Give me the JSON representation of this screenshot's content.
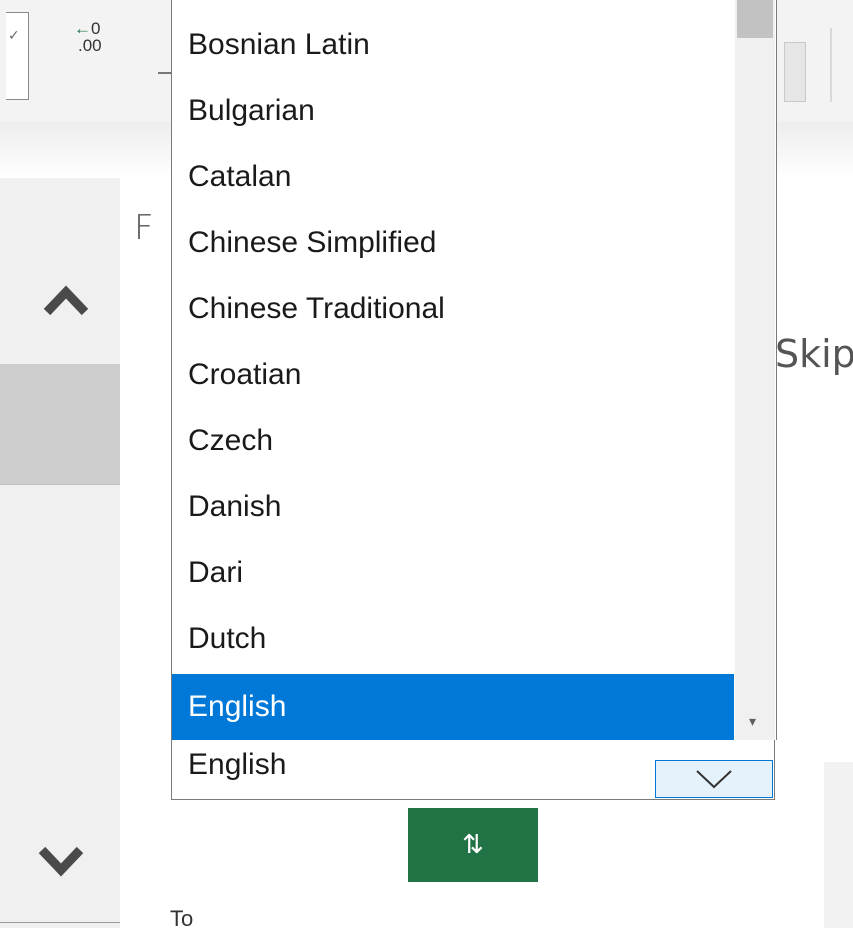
{
  "ribbon": {
    "decimal_top": "0",
    "decimal_arrow": "←",
    "decimal_bottom": ".00"
  },
  "background_text": {
    "from_partial": "F",
    "skip_partial": "Skip",
    "to_partial": "To"
  },
  "dropdown": {
    "items": [
      {
        "label": "Bosnian Latin",
        "selected": false
      },
      {
        "label": "Bulgarian",
        "selected": false
      },
      {
        "label": "Catalan",
        "selected": false
      },
      {
        "label": "Chinese Simplified",
        "selected": false
      },
      {
        "label": "Chinese Traditional",
        "selected": false
      },
      {
        "label": "Croatian",
        "selected": false
      },
      {
        "label": "Czech",
        "selected": false
      },
      {
        "label": "Danish",
        "selected": false
      },
      {
        "label": "Dari",
        "selected": false
      },
      {
        "label": "Dutch",
        "selected": false
      },
      {
        "label": "English",
        "selected": true
      }
    ]
  },
  "select": {
    "value": "English"
  },
  "swap_button": {
    "label": "⇅"
  },
  "colors": {
    "selected_bg": "#0078d7",
    "accent_green": "#217346"
  }
}
